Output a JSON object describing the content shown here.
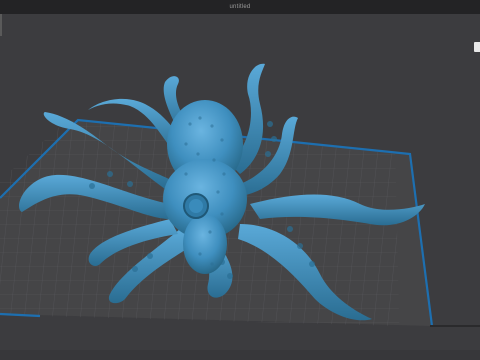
{
  "app": {
    "window_title": "untitled"
  },
  "viewport": {
    "model_name": "octopus",
    "model_color": "#3f8fbf",
    "plate_color": "#464648",
    "grid_color": "#5c5c60",
    "border_color": "#1d6fb0",
    "background_color": "#3c3c3f"
  },
  "icons": {
    "viewcube": "corner-handle-icon"
  }
}
